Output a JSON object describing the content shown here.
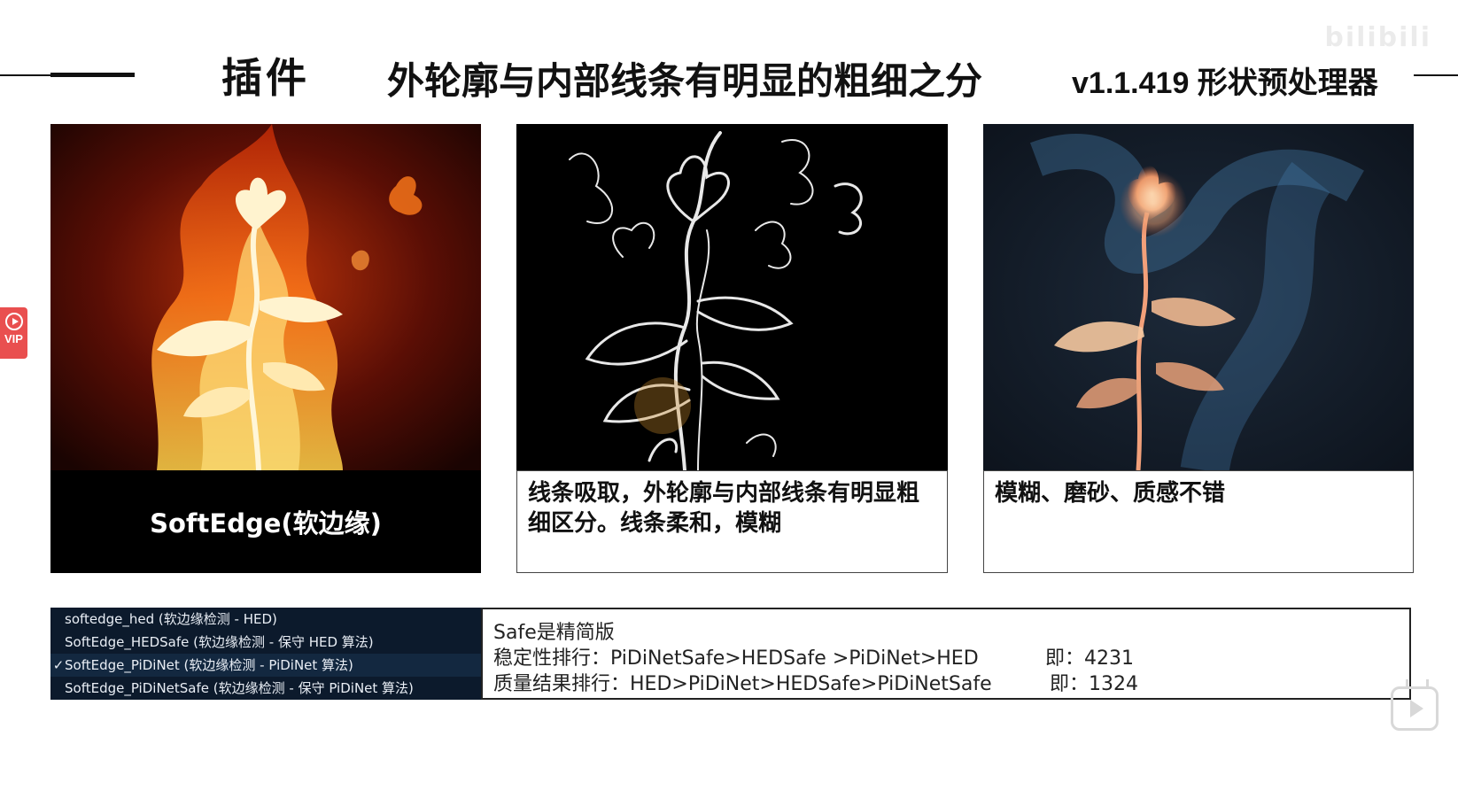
{
  "header": {
    "plugin_label": "插件",
    "title": "外轮廓与内部线条有明显的粗细之分",
    "version": "v1.1.419 形状预处理器",
    "watermark": "bilibili"
  },
  "panels": [
    {
      "caption": "SoftEdge(软边缘)"
    },
    {
      "caption": "线条吸取，外轮廓与内部线条有明显粗细区分。线条柔和，模糊"
    },
    {
      "caption": "模糊、磨砂、质感不错"
    }
  ],
  "side_badge": {
    "label": "VIP"
  },
  "menu": {
    "items": [
      {
        "label": "softedge_hed (软边缘检测 - HED)",
        "checked": false
      },
      {
        "label": "SoftEdge_HEDSafe (软边缘检测 - 保守 HED 算法)",
        "checked": false
      },
      {
        "label": "SoftEdge_PiDiNet (软边缘检测 - PiDiNet 算法)",
        "checked": true
      },
      {
        "label": "SoftEdge_PiDiNetSafe (软边缘检测 - 保守 PiDiNet 算法)",
        "checked": false
      }
    ],
    "check_mark": "✓"
  },
  "info": {
    "line1": "Safe是精简版",
    "line2": "稳定性排行：PiDiNetSafe>HEDSafe >PiDiNet>HED",
    "line2_eq": "即：4231",
    "line3": "质量结果排行：HED>PiDiNet>HEDSafe>PiDiNetSafe",
    "line3_eq": "即：1324"
  },
  "colors": {
    "flame_orange": "#ff7a1a",
    "smoke_blue": "#4a86b8",
    "menu_bg": "#0c1a2c",
    "badge_red": "#e94f4f"
  }
}
